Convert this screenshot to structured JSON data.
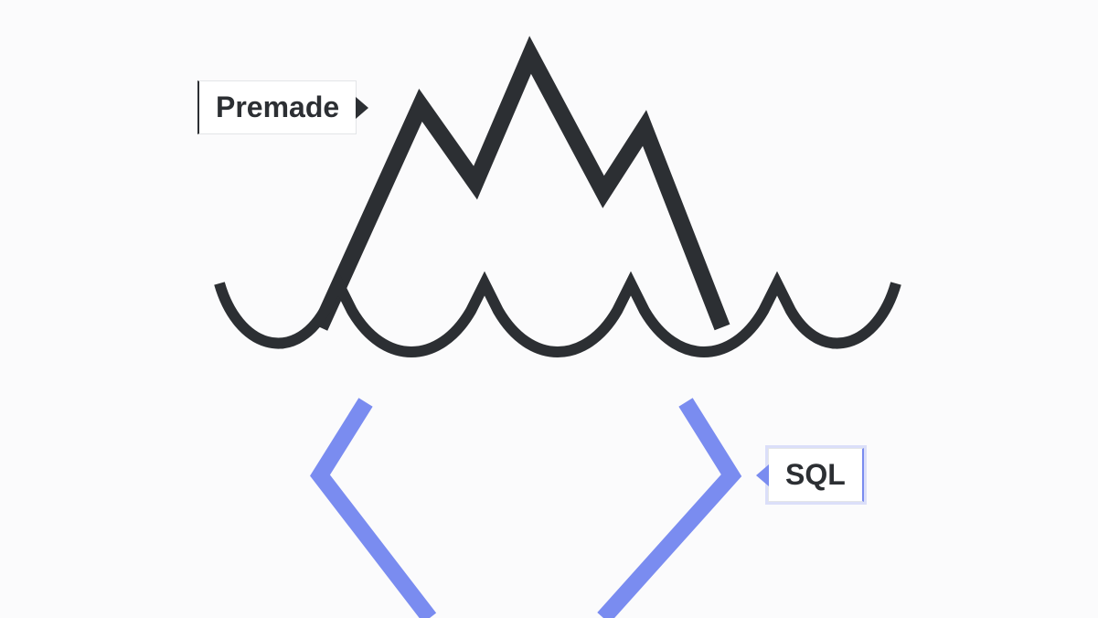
{
  "diagram": {
    "labels": {
      "premade": "Premade",
      "sql": "SQL"
    },
    "colors": {
      "iceberg_stroke": "#2c2f33",
      "sql_stroke": "#7a8cf0",
      "background": "#fbfbfc",
      "label_bg": "#ffffff"
    }
  }
}
